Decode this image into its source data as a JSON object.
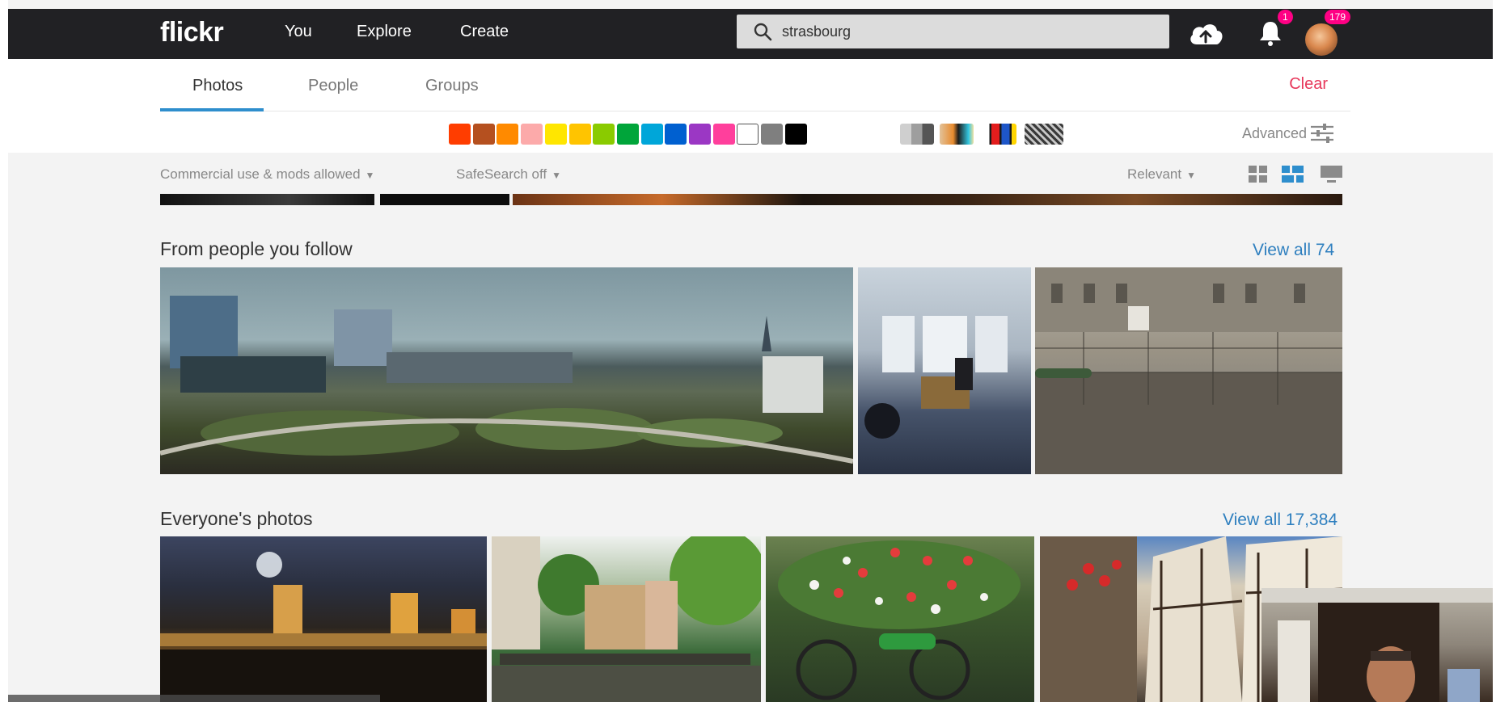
{
  "brand": {
    "logo": "flickr",
    "accent": "#2e8ecd",
    "clear_color": "#e7385b",
    "link_color": "#2e7fbf"
  },
  "nav": {
    "links": [
      "You",
      "Explore",
      "Create"
    ],
    "search_value": "strasbourg",
    "icons": [
      "upload-cloud-icon",
      "notification-bell-icon",
      "avatar"
    ],
    "notification_count": "1",
    "avatar_count": "179"
  },
  "tabs": [
    {
      "label": "Photos",
      "active": true
    },
    {
      "label": "People",
      "active": false
    },
    {
      "label": "Groups",
      "active": false
    }
  ],
  "clear_label": "Clear",
  "color_swatches": [
    "#ff3d00",
    "#b5501f",
    "#ff8a00",
    "#fcaaaa",
    "#ffe600",
    "#ffc400",
    "#8acb00",
    "#00a53a",
    "#00a6d9",
    "#0060d0",
    "#9b37c4",
    "#ff3f9c",
    "#ffffff",
    "#7f7f7f",
    "#000000"
  ],
  "style_swatches": [
    "black-and-white",
    "shallow-depth-of-field",
    "minimalist",
    "patterns"
  ],
  "advanced_label": "Advanced",
  "filters": {
    "license": "Commercial use & mods allowed",
    "safesearch": "SafeSearch off",
    "sort": "Relevant",
    "view_modes": [
      "grid-view-icon",
      "justified-view-icon",
      "detail-view-icon"
    ]
  },
  "sections": [
    {
      "title": "From people you follow",
      "view_all": "View all 74"
    },
    {
      "title": "Everyone's photos",
      "view_all": "View all 17,384"
    }
  ]
}
